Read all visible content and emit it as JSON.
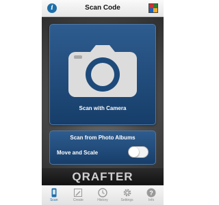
{
  "navbar": {
    "title": "Scan Code",
    "info_icon": "info-icon",
    "info_glyph": "i",
    "app_icon": "app-grid-icon",
    "app_icon_colors": [
      "#d32f2f",
      "#2e7d32",
      "#1565c0",
      "#f9a825"
    ]
  },
  "main": {
    "scan_camera": {
      "label": "Scan with Camera",
      "icon": "camera-icon"
    },
    "scan_albums": {
      "label": "Scan from Photo Albums"
    },
    "move_and_scale": {
      "label": "Move and Scale",
      "enabled": false
    }
  },
  "brand": {
    "name": "QRAFTER"
  },
  "tabbar": {
    "active": "Scan",
    "tabs": [
      {
        "label": "Scan",
        "icon": "phone-icon"
      },
      {
        "label": "Create",
        "icon": "pencil-icon"
      },
      {
        "label": "History",
        "icon": "clock-icon"
      },
      {
        "label": "Settings",
        "icon": "gear-icon"
      },
      {
        "label": "Info",
        "icon": "help-icon"
      }
    ]
  },
  "colors": {
    "accent": "#1f6fa8",
    "button_blue": "#2e5c8f",
    "dark_background": "#2b2b2b"
  }
}
